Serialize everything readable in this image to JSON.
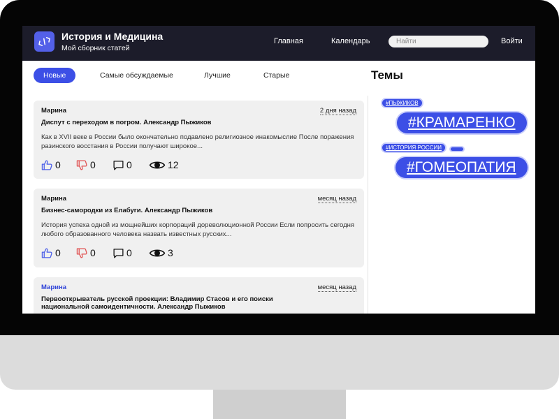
{
  "header": {
    "title": "История и Медицина",
    "subtitle": "Мой сборник статей",
    "logo_icon": "code-brackets-icon",
    "nav": {
      "home": "Главная",
      "calendar": "Календарь",
      "login": "Войти"
    },
    "search_placeholder": "Найти"
  },
  "tabs": [
    {
      "label": "Новые",
      "active": true
    },
    {
      "label": "Самые обсуждаемые",
      "active": false
    },
    {
      "label": "Лучшие",
      "active": false
    },
    {
      "label": "Старые",
      "active": false
    }
  ],
  "posts": [
    {
      "author": "Марина",
      "time": "2 дня назад",
      "title": "Диспут с переходом в погром. Александр Пыжиков",
      "excerpt": "Как в XVII веке в России было окончательно подавлено религиозное инакомыслие После поражения разинского восстания в России получают широкое...",
      "likes": "0",
      "dislikes": "0",
      "comments": "0",
      "views": "12"
    },
    {
      "author": "Марина",
      "time": "месяц назад",
      "title": "Бизнес-самородки из Елабуги. Александр Пыжиков",
      "excerpt": "История успеха одной из мощнейших корпораций дореволюционной России Если попросить сегодня любого образованного человека назвать известных русских...",
      "likes": "0",
      "dislikes": "0",
      "comments": "0",
      "views": "3"
    },
    {
      "author": "Марина",
      "time": "месяц назад",
      "title": "Первооткрыватель русской проекции: Владимир Стасов и его поиски национальной самоидентичности. Александр Пыжиков"
    }
  ],
  "topics": {
    "heading": "Темы",
    "tags": [
      "#ПЫЖИКОВ",
      "#КРАМАРЕНКО",
      "#ИСТОРИЯ РОССИИ",
      "",
      "#ГОМЕОПАТИЯ"
    ]
  },
  "colors": {
    "accent": "#3c4fe6",
    "topbar": "#1c1c2a",
    "card_bg": "#f0f0f0",
    "dislike": "#e05050"
  },
  "icons": {
    "like": "thumbs-up-icon",
    "dislike": "thumbs-down-icon",
    "comment": "comment-icon",
    "views": "eye-icon"
  }
}
